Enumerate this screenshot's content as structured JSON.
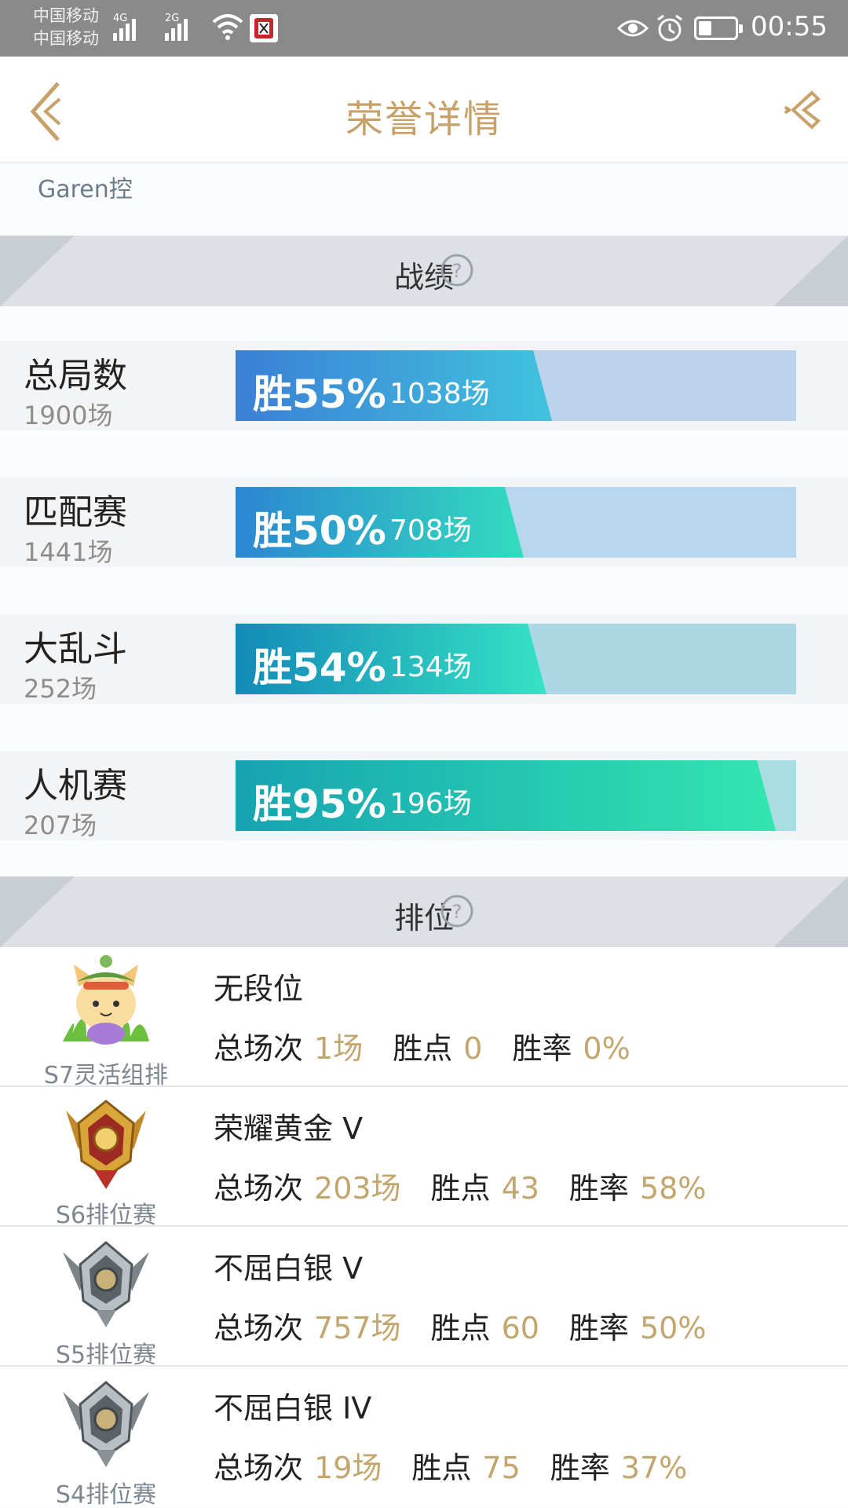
{
  "status_bar": {
    "carrier_1": "中国移动",
    "carrier_2": "中国移动",
    "net_1": "4G",
    "net_2": "2G",
    "time": "00:55"
  },
  "header": {
    "title": "荣誉详情",
    "back_icon": "chevron-left-icon",
    "share_icon": "share-icon"
  },
  "nickname": "Garen控",
  "record_section": {
    "title": "战绩"
  },
  "stats": [
    {
      "mode": "总局数",
      "total": "1900场",
      "win_label": "胜55%",
      "win_count": "1038场",
      "win_rate": 0.55,
      "from": "#3a7fd5",
      "to": "#41c3dd",
      "track": "#bcd3ec"
    },
    {
      "mode": "匹配赛",
      "total": "1441场",
      "win_label": "胜50%",
      "win_count": "708场",
      "win_rate": 0.5,
      "from": "#2b86d2",
      "to": "#33dcbe",
      "track": "#b8d7ee"
    },
    {
      "mode": "大乱斗",
      "total": "252场",
      "win_label": "胜54%",
      "win_count": "134场",
      "win_rate": 0.54,
      "from": "#138ab8",
      "to": "#36e2c4",
      "track": "#acd8e6"
    },
    {
      "mode": "人机赛",
      "total": "207场",
      "win_label": "胜95%",
      "win_count": "196场",
      "win_rate": 0.95,
      "from": "#16a3b2",
      "to": "#32e6b0",
      "track": "#a9dde2"
    }
  ],
  "rank_section": {
    "title": "排位"
  },
  "ranks": [
    {
      "season": "S7灵活组排",
      "tier": "无段位",
      "games_label": "总场次",
      "games": "1场",
      "points_label": "胜点",
      "points": "0",
      "rate_label": "胜率",
      "rate": "0%",
      "icon": "teemo-avatar-icon"
    },
    {
      "season": "S6排位赛",
      "tier": "荣耀黄金 V",
      "games_label": "总场次",
      "games": "203场",
      "points_label": "胜点",
      "points": "43",
      "rate_label": "胜率",
      "rate": "58%",
      "icon": "gold-rank-emblem-icon"
    },
    {
      "season": "S5排位赛",
      "tier": "不屈白银 V",
      "games_label": "总场次",
      "games": "757场",
      "points_label": "胜点",
      "points": "60",
      "rate_label": "胜率",
      "rate": "50%",
      "icon": "silver-rank-emblem-icon"
    },
    {
      "season": "S4排位赛",
      "tier": "不屈白银 IV",
      "games_label": "总场次",
      "games": "19场",
      "points_label": "胜点",
      "points": "75",
      "rate_label": "胜率",
      "rate": "37%",
      "icon": "silver-rank-emblem-icon"
    }
  ],
  "colors": {
    "accent_gold": "#c7a169",
    "value_gold": "#c3a56e"
  }
}
